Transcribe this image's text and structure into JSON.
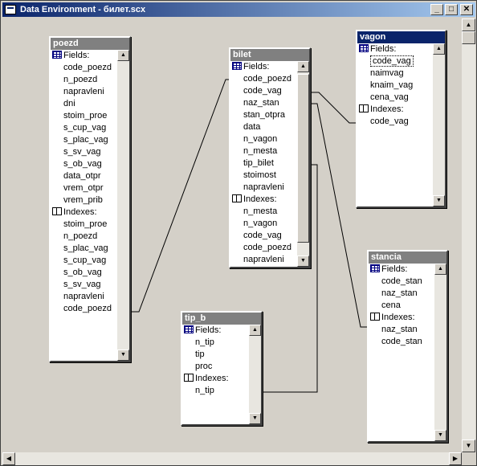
{
  "window": {
    "title": "Data Environment - билет.scx",
    "buttons": {
      "minimize": "_",
      "maximize": "□",
      "close": "✕"
    }
  },
  "scroll": {
    "up": "▲",
    "down": "▼",
    "left": "◀",
    "right": "▶"
  },
  "tables": {
    "poezd": {
      "title": "poezd",
      "fields_label": "Fields:",
      "fields": [
        "code_poezd",
        "n_poezd",
        "napravleni",
        "dni",
        "stoim_proe",
        "s_cup_vag",
        "s_plac_vag",
        "s_sv_vag",
        "s_ob_vag",
        "data_otpr",
        "vrem_otpr",
        "vrem_prib"
      ],
      "indexes_label": "Indexes:",
      "indexes": [
        "stoim_proe",
        "n_poezd",
        "s_plac_vag",
        "s_cup_vag",
        "s_ob_vag",
        "s_sv_vag",
        "napravleni",
        "code_poezd"
      ]
    },
    "bilet": {
      "title": "bilet",
      "fields_label": "Fields:",
      "fields": [
        "code_poezd",
        "code_vag",
        "naz_stan",
        "stan_otpra",
        "data",
        "n_vagon",
        "n_mesta",
        "tip_bilet",
        "stoimost",
        "napravleni"
      ],
      "indexes_label": "Indexes:",
      "indexes": [
        "n_mesta",
        "n_vagon",
        "code_vag",
        "code_poezd",
        "napravleni"
      ]
    },
    "vagon": {
      "title": "vagon",
      "fields_label": "Fields:",
      "fields": [
        "code_vag",
        "naimvag",
        "knaim_vag",
        "cena_vag"
      ],
      "indexes_label": "Indexes:",
      "indexes": [
        "code_vag"
      ]
    },
    "stancia": {
      "title": "stancia",
      "fields_label": "Fields:",
      "fields": [
        "code_stan",
        "naz_stan",
        "cena"
      ],
      "indexes_label": "Indexes:",
      "indexes": [
        "naz_stan",
        "code_stan"
      ]
    },
    "tip_b": {
      "title": "tip_b",
      "fields_label": "Fields:",
      "fields": [
        "n_tip",
        "tip",
        "proc"
      ],
      "indexes_label": "Indexes:",
      "indexes": [
        "n_tip"
      ]
    }
  }
}
